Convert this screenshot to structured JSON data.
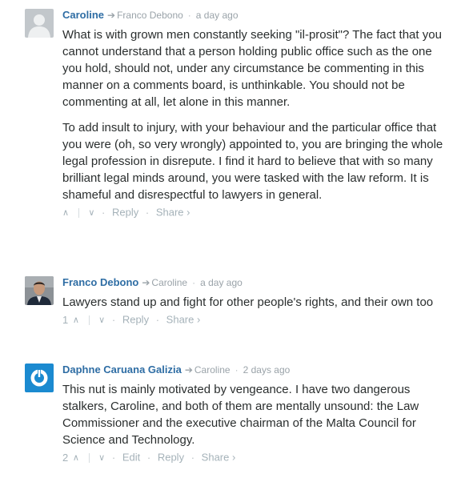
{
  "comments": [
    {
      "author": "Caroline",
      "reply_to": "Franco Debono",
      "time": "a day ago",
      "avatar": "default-avatar",
      "paragraphs": [
        "What is with grown men constantly seeking \"il-prosit\"? The fact that you cannot understand that a person holding public office such as the one you hold, should not, under any circumstance be commenting in this manner on a comments board, is unthinkable. You should not be commenting at all, let alone in this manner.",
        "To add insult to injury, with your behaviour and the particular office that you were (oh, so very wrongly) appointed to, you are bringing the whole legal profession in disrepute. I find it hard to believe that with so many brilliant legal minds around, you were tasked with the law reform. It is shameful and disrespectful to lawyers in general."
      ],
      "votes": "",
      "actions": [
        "Reply",
        "Share ›"
      ]
    },
    {
      "author": "Franco Debono",
      "reply_to": "Caroline",
      "time": "a day ago",
      "avatar": "photo-avatar",
      "paragraphs": [
        "Lawyers stand up and fight for other people's rights, and their own too"
      ],
      "votes": "1",
      "actions": [
        "Reply",
        "Share ›"
      ]
    },
    {
      "author": "Daphne Caruana Galizia",
      "reply_to": "Caroline",
      "time": "2 days ago",
      "avatar": "power-logo-avatar",
      "paragraphs": [
        "This nut is mainly motivated by vengeance. I have two dangerous stalkers, Caroline, and both of them are mentally unsound: the Law Commissioner and the executive chairman of the Malta Council for Science and Technology."
      ],
      "votes": "2",
      "actions": [
        "Edit",
        "Reply",
        "Share ›"
      ]
    }
  ],
  "glyphs": {
    "reply_arrow": "➔",
    "dot": "·",
    "up": "∧",
    "down": "∨"
  },
  "colors": {
    "author": "#2e6da4",
    "meta": "#9aa3a9",
    "text": "#2a2e2e",
    "avatar_blue": "#1b8ad0"
  }
}
